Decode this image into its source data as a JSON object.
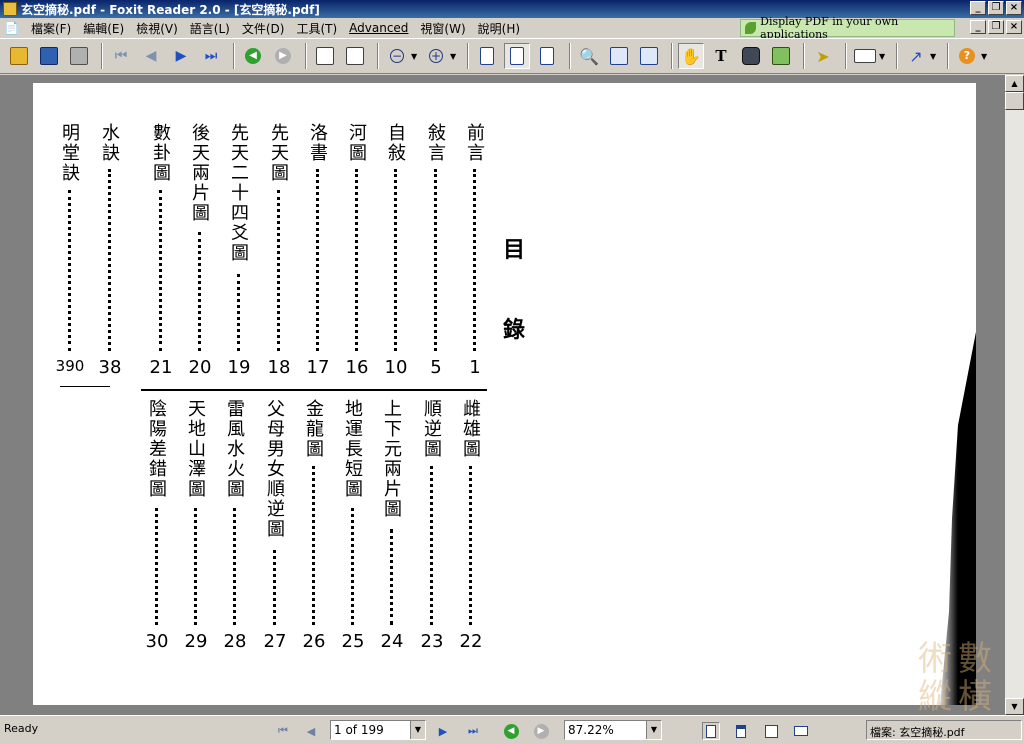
{
  "window": {
    "title": "玄空摘秘.pdf - Foxit Reader 2.0 - [玄空摘秘.pdf]"
  },
  "menu": {
    "items": [
      "檔案(F)",
      "編輯(E)",
      "檢視(V)",
      "語言(L)",
      "文件(D)",
      "工具(T)",
      "Advanced",
      "視窗(W)",
      "說明(H)"
    ],
    "ad_text": "Display PDF in your own applications"
  },
  "toolbar": {
    "icons": [
      "open-icon",
      "save-icon",
      "print-icon",
      "first-page-icon",
      "prev-page-icon",
      "next-page-icon",
      "last-page-icon",
      "back-icon",
      "forward-icon",
      "extract-page-icon",
      "insert-page-icon",
      "zoom-out-icon",
      "zoom-in-icon",
      "actual-size-icon",
      "fit-page-icon",
      "fit-width-icon",
      "find-icon",
      "bookmarks-icon",
      "thumbnails-icon",
      "hand-tool-icon",
      "text-select-icon",
      "snapshot-icon",
      "image-tool-icon",
      "select-tool-icon",
      "annotation-icon",
      "arrow-tool-icon",
      "help-icon"
    ]
  },
  "document": {
    "heading": "目錄",
    "upper_entries": [
      {
        "title": "前言",
        "page": "1"
      },
      {
        "title": "敍言",
        "page": "5"
      },
      {
        "title": "自敍",
        "page": "10"
      },
      {
        "title": "河圖",
        "page": "16"
      },
      {
        "title": "洛書",
        "page": "17"
      },
      {
        "title": "先天圖",
        "page": "18"
      },
      {
        "title": "先天二十四爻圖",
        "page": "19"
      },
      {
        "title": "後天兩片圖",
        "page": "20"
      },
      {
        "title": "數卦圖",
        "page": "21"
      },
      {
        "title": "水訣",
        "page": "38"
      },
      {
        "title": "明堂訣",
        "page": "390"
      }
    ],
    "lower_entries": [
      {
        "title": "雌雄圖",
        "page": "22"
      },
      {
        "title": "順逆圖",
        "page": "23"
      },
      {
        "title": "上下元兩片圖",
        "page": "24"
      },
      {
        "title": "地運長短圖",
        "page": "25"
      },
      {
        "title": "金龍圖",
        "page": "26"
      },
      {
        "title": "父母男女順逆圖",
        "page": "27"
      },
      {
        "title": "雷風水火圖",
        "page": "28"
      },
      {
        "title": "天地山澤圖",
        "page": "29"
      },
      {
        "title": "陰陽差錯圖",
        "page": "30"
      }
    ]
  },
  "status": {
    "ready": "Ready",
    "page_field": "1 of 199",
    "zoom_field": "87.22%",
    "filename": "檔案: 玄空摘秘.pdf"
  },
  "watermark": "術數縱橫"
}
